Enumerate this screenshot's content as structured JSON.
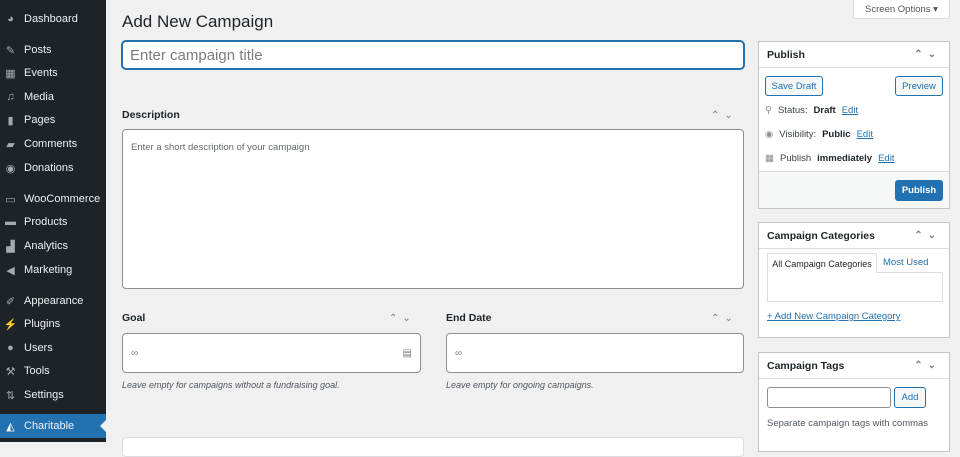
{
  "sidebar": {
    "items": [
      {
        "label": "Dashboard",
        "icon": "dashboard-icon",
        "glyph": "◕"
      },
      {
        "label": "Posts",
        "icon": "pin-icon",
        "glyph": "✎"
      },
      {
        "label": "Events",
        "icon": "calendar-icon",
        "glyph": "▦"
      },
      {
        "label": "Media",
        "icon": "media-icon",
        "glyph": "♫"
      },
      {
        "label": "Pages",
        "icon": "pages-icon",
        "glyph": "▮"
      },
      {
        "label": "Comments",
        "icon": "comment-icon",
        "glyph": "▰"
      },
      {
        "label": "Donations",
        "icon": "donations-icon",
        "glyph": "◉"
      },
      {
        "label": "WooCommerce",
        "icon": "woo-icon",
        "glyph": "▭"
      },
      {
        "label": "Products",
        "icon": "products-icon",
        "glyph": "▬"
      },
      {
        "label": "Analytics",
        "icon": "analytics-icon",
        "glyph": "▟"
      },
      {
        "label": "Marketing",
        "icon": "megaphone-icon",
        "glyph": "◀"
      },
      {
        "label": "Appearance",
        "icon": "brush-icon",
        "glyph": "✐"
      },
      {
        "label": "Plugins",
        "icon": "plug-icon",
        "glyph": "⚡"
      },
      {
        "label": "Users",
        "icon": "user-icon",
        "glyph": "●"
      },
      {
        "label": "Tools",
        "icon": "wrench-icon",
        "glyph": "⚒"
      },
      {
        "label": "Settings",
        "icon": "settings-icon",
        "glyph": "⇅"
      },
      {
        "label": "Charitable",
        "icon": "charitable-icon",
        "glyph": "◭"
      }
    ]
  },
  "header": {
    "title": "Add New Campaign",
    "screen_options": "Screen Options ▾"
  },
  "title_input": {
    "placeholder": "Enter campaign title"
  },
  "description": {
    "label": "Description",
    "placeholder": "Enter a short description of your campaign"
  },
  "goal": {
    "label": "Goal",
    "value": "∞",
    "help": "Leave empty for campaigns without a fundraising goal."
  },
  "end_date": {
    "label": "End Date",
    "value": "∞",
    "help": "Leave empty for ongoing campaigns."
  },
  "publish": {
    "title": "Publish",
    "save_draft": "Save Draft",
    "preview": "Preview",
    "status_label": "Status:",
    "status": "Draft",
    "visibility_label": "Visibility:",
    "visibility": "Public",
    "publish_label": "Publish",
    "publish_when": "immediately",
    "edit": "Edit",
    "publish_button": "Publish"
  },
  "categories": {
    "title": "Campaign Categories",
    "tab_all": "All Campaign Categories",
    "tab_most": "Most Used",
    "add_link": "+ Add New Campaign Category"
  },
  "tags": {
    "title": "Campaign Tags",
    "add": "Add",
    "help": "Separate campaign tags with commas"
  }
}
